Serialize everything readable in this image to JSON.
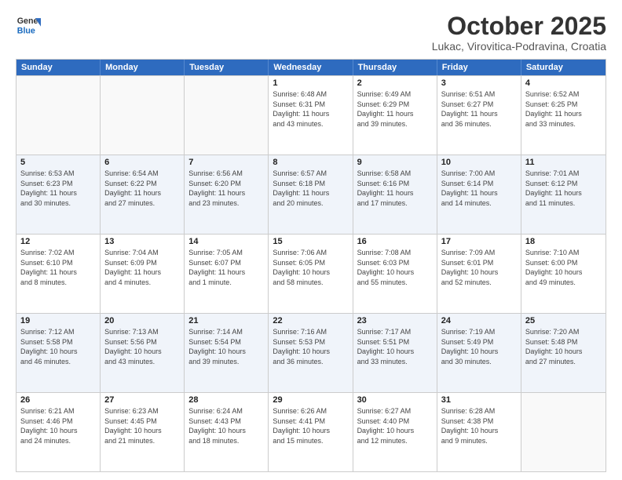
{
  "header": {
    "logo_line1": "General",
    "logo_line2": "Blue",
    "month": "October 2025",
    "location": "Lukac, Virovitica-Podravina, Croatia"
  },
  "weekdays": [
    "Sunday",
    "Monday",
    "Tuesday",
    "Wednesday",
    "Thursday",
    "Friday",
    "Saturday"
  ],
  "rows": [
    [
      {
        "day": "",
        "info": ""
      },
      {
        "day": "",
        "info": ""
      },
      {
        "day": "",
        "info": ""
      },
      {
        "day": "1",
        "info": "Sunrise: 6:48 AM\nSunset: 6:31 PM\nDaylight: 11 hours\nand 43 minutes."
      },
      {
        "day": "2",
        "info": "Sunrise: 6:49 AM\nSunset: 6:29 PM\nDaylight: 11 hours\nand 39 minutes."
      },
      {
        "day": "3",
        "info": "Sunrise: 6:51 AM\nSunset: 6:27 PM\nDaylight: 11 hours\nand 36 minutes."
      },
      {
        "day": "4",
        "info": "Sunrise: 6:52 AM\nSunset: 6:25 PM\nDaylight: 11 hours\nand 33 minutes."
      }
    ],
    [
      {
        "day": "5",
        "info": "Sunrise: 6:53 AM\nSunset: 6:23 PM\nDaylight: 11 hours\nand 30 minutes."
      },
      {
        "day": "6",
        "info": "Sunrise: 6:54 AM\nSunset: 6:22 PM\nDaylight: 11 hours\nand 27 minutes."
      },
      {
        "day": "7",
        "info": "Sunrise: 6:56 AM\nSunset: 6:20 PM\nDaylight: 11 hours\nand 23 minutes."
      },
      {
        "day": "8",
        "info": "Sunrise: 6:57 AM\nSunset: 6:18 PM\nDaylight: 11 hours\nand 20 minutes."
      },
      {
        "day": "9",
        "info": "Sunrise: 6:58 AM\nSunset: 6:16 PM\nDaylight: 11 hours\nand 17 minutes."
      },
      {
        "day": "10",
        "info": "Sunrise: 7:00 AM\nSunset: 6:14 PM\nDaylight: 11 hours\nand 14 minutes."
      },
      {
        "day": "11",
        "info": "Sunrise: 7:01 AM\nSunset: 6:12 PM\nDaylight: 11 hours\nand 11 minutes."
      }
    ],
    [
      {
        "day": "12",
        "info": "Sunrise: 7:02 AM\nSunset: 6:10 PM\nDaylight: 11 hours\nand 8 minutes."
      },
      {
        "day": "13",
        "info": "Sunrise: 7:04 AM\nSunset: 6:09 PM\nDaylight: 11 hours\nand 4 minutes."
      },
      {
        "day": "14",
        "info": "Sunrise: 7:05 AM\nSunset: 6:07 PM\nDaylight: 11 hours\nand 1 minute."
      },
      {
        "day": "15",
        "info": "Sunrise: 7:06 AM\nSunset: 6:05 PM\nDaylight: 10 hours\nand 58 minutes."
      },
      {
        "day": "16",
        "info": "Sunrise: 7:08 AM\nSunset: 6:03 PM\nDaylight: 10 hours\nand 55 minutes."
      },
      {
        "day": "17",
        "info": "Sunrise: 7:09 AM\nSunset: 6:01 PM\nDaylight: 10 hours\nand 52 minutes."
      },
      {
        "day": "18",
        "info": "Sunrise: 7:10 AM\nSunset: 6:00 PM\nDaylight: 10 hours\nand 49 minutes."
      }
    ],
    [
      {
        "day": "19",
        "info": "Sunrise: 7:12 AM\nSunset: 5:58 PM\nDaylight: 10 hours\nand 46 minutes."
      },
      {
        "day": "20",
        "info": "Sunrise: 7:13 AM\nSunset: 5:56 PM\nDaylight: 10 hours\nand 43 minutes."
      },
      {
        "day": "21",
        "info": "Sunrise: 7:14 AM\nSunset: 5:54 PM\nDaylight: 10 hours\nand 39 minutes."
      },
      {
        "day": "22",
        "info": "Sunrise: 7:16 AM\nSunset: 5:53 PM\nDaylight: 10 hours\nand 36 minutes."
      },
      {
        "day": "23",
        "info": "Sunrise: 7:17 AM\nSunset: 5:51 PM\nDaylight: 10 hours\nand 33 minutes."
      },
      {
        "day": "24",
        "info": "Sunrise: 7:19 AM\nSunset: 5:49 PM\nDaylight: 10 hours\nand 30 minutes."
      },
      {
        "day": "25",
        "info": "Sunrise: 7:20 AM\nSunset: 5:48 PM\nDaylight: 10 hours\nand 27 minutes."
      }
    ],
    [
      {
        "day": "26",
        "info": "Sunrise: 6:21 AM\nSunset: 4:46 PM\nDaylight: 10 hours\nand 24 minutes."
      },
      {
        "day": "27",
        "info": "Sunrise: 6:23 AM\nSunset: 4:45 PM\nDaylight: 10 hours\nand 21 minutes."
      },
      {
        "day": "28",
        "info": "Sunrise: 6:24 AM\nSunset: 4:43 PM\nDaylight: 10 hours\nand 18 minutes."
      },
      {
        "day": "29",
        "info": "Sunrise: 6:26 AM\nSunset: 4:41 PM\nDaylight: 10 hours\nand 15 minutes."
      },
      {
        "day": "30",
        "info": "Sunrise: 6:27 AM\nSunset: 4:40 PM\nDaylight: 10 hours\nand 12 minutes."
      },
      {
        "day": "31",
        "info": "Sunrise: 6:28 AM\nSunset: 4:38 PM\nDaylight: 10 hours\nand 9 minutes."
      },
      {
        "day": "",
        "info": ""
      }
    ]
  ]
}
